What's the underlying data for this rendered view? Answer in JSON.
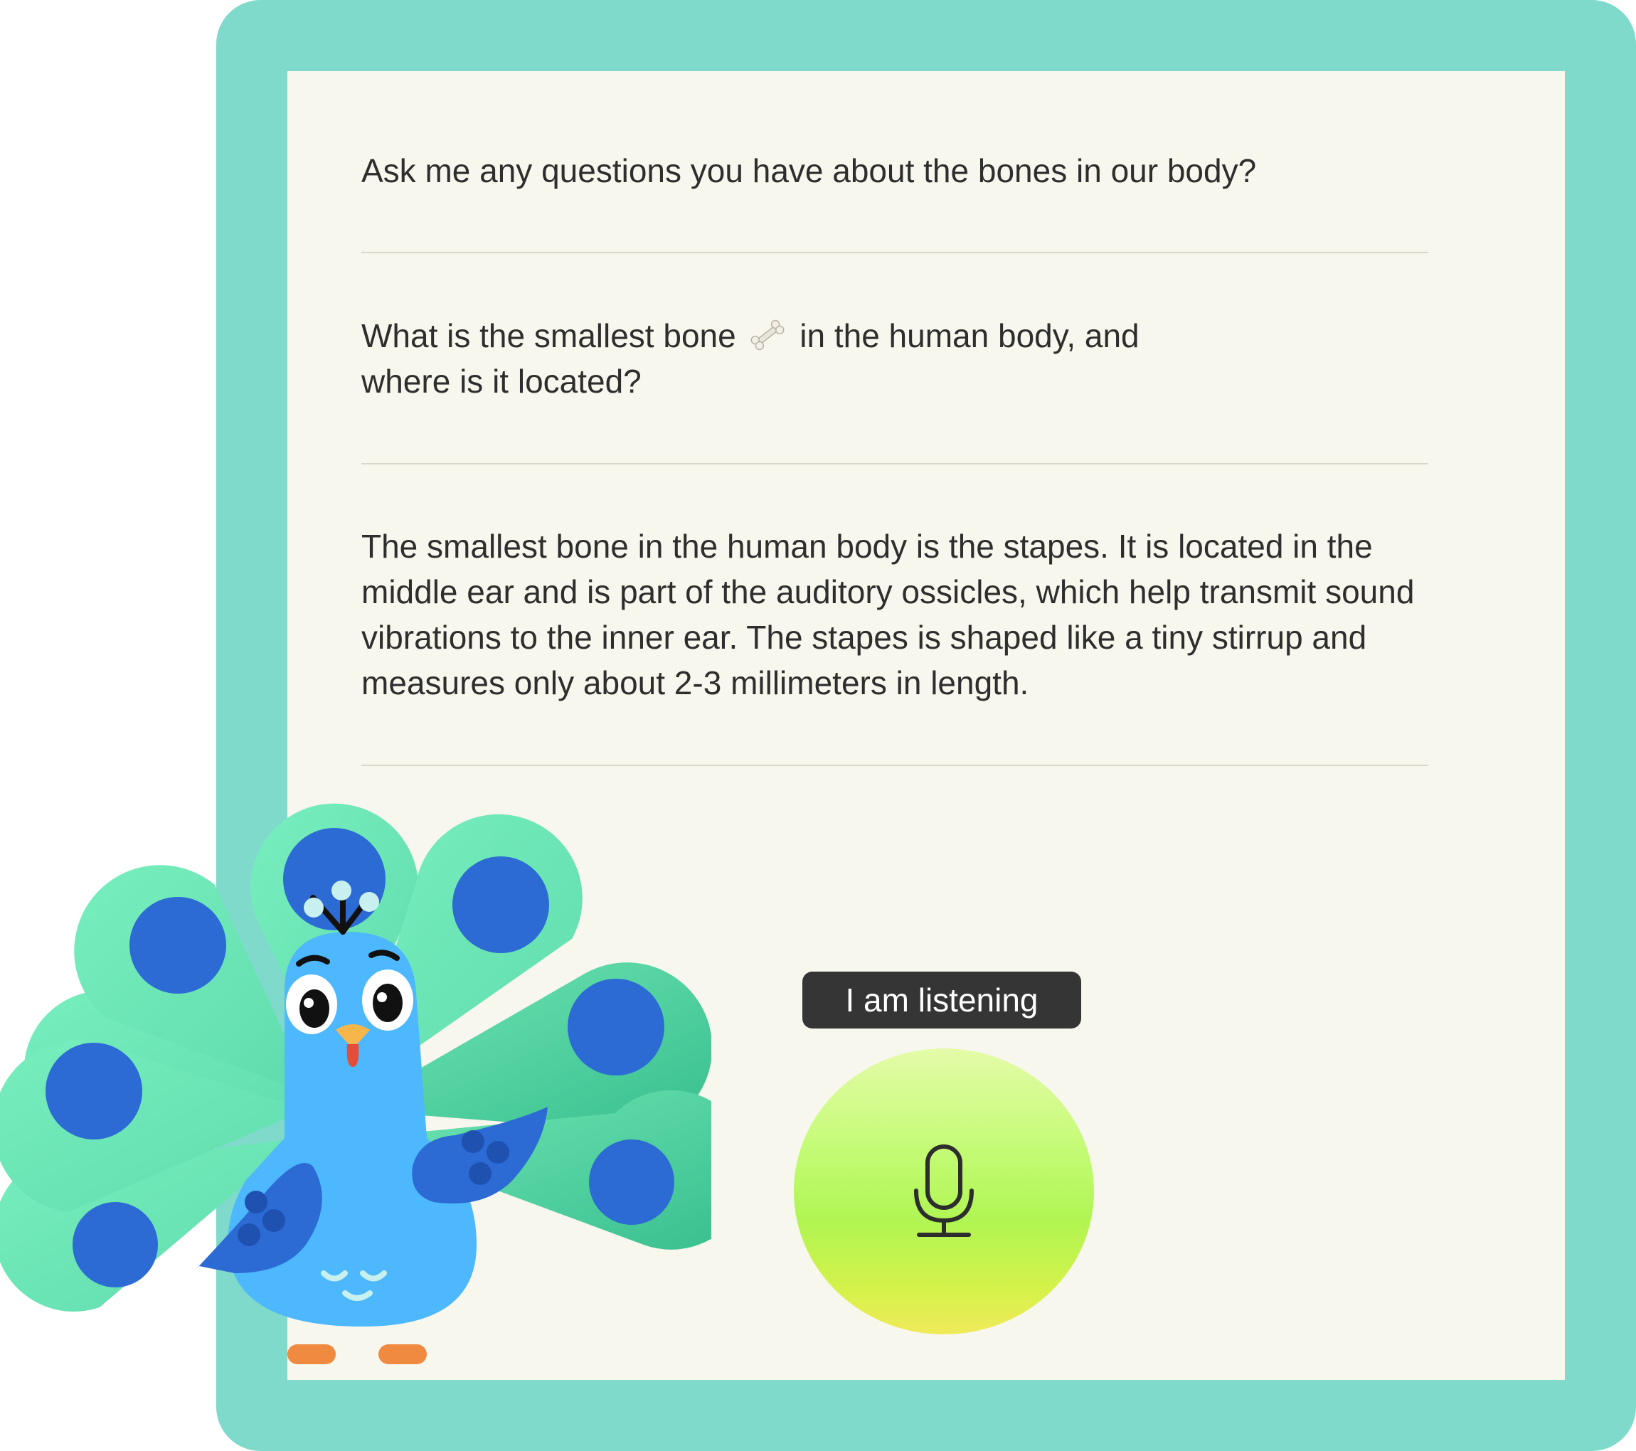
{
  "conversation": {
    "prompt": "Ask me any questions you have about the bones in our body?",
    "question": {
      "before_icon": "What is the smallest bone",
      "icon": "bone-icon",
      "after_icon": "in the human body, and where is it located?"
    },
    "answer": "The smallest bone in the human body is the stapes. It is located in the middle ear and is part of the auditory ossicles, which help transmit sound vibrations to the inner ear. The stapes is shaped like a tiny stirrup and measures only about 2-3 millimeters in length."
  },
  "voice_input": {
    "status_label": "I am listening",
    "icon": "microphone-icon"
  },
  "mascot": {
    "icon": "peacock-mascot"
  },
  "colors": {
    "frame": "#7fdacb",
    "screen": "#f8f7ed",
    "badge": "#353535",
    "mic_gradient_top": "#e4fba8",
    "mic_gradient_mid": "#b0f553",
    "mic_gradient_bottom": "#f0ea5a",
    "peacock_body": "#4db8fe",
    "peacock_feather": "#72ecb7",
    "peacock_eye_spot": "#2c6ad4",
    "peacock_feet": "#ef8a40"
  }
}
